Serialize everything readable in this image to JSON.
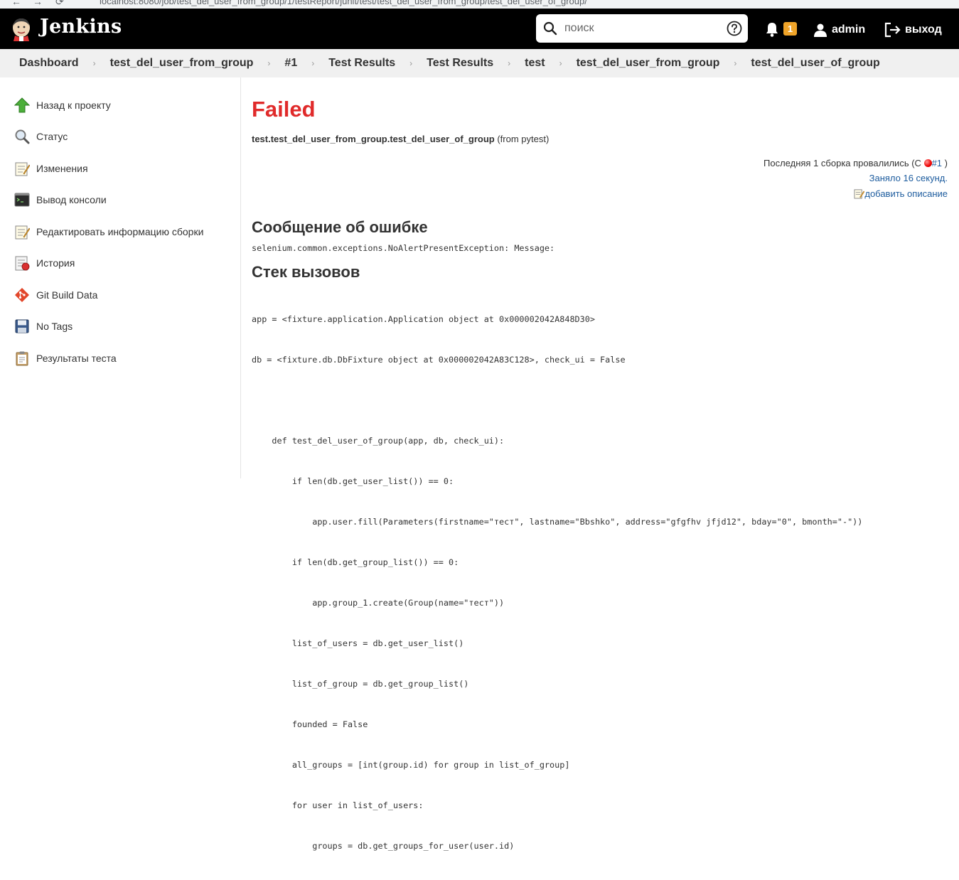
{
  "browser": {
    "url": "localhost:8080/job/test_del_user_from_group/1/testReport/junit/test/test_del_user_from_group/test_del_user_of_group/"
  },
  "header": {
    "brand": "Jenkins",
    "search_placeholder": "поиск",
    "notification_count": "1",
    "user_name": "admin",
    "logout_label": "выход"
  },
  "breadcrumbs": [
    "Dashboard",
    "test_del_user_from_group",
    "#1",
    "Test Results",
    "Test Results",
    "test",
    "test_del_user_from_group",
    "test_del_user_of_group"
  ],
  "sidebar": {
    "items": [
      {
        "label": "Назад к проекту",
        "icon": "up-arrow-icon"
      },
      {
        "label": "Статус",
        "icon": "magnifier-icon"
      },
      {
        "label": "Изменения",
        "icon": "notepad-icon"
      },
      {
        "label": "Вывод консоли",
        "icon": "terminal-icon"
      },
      {
        "label": "Редактировать информацию сборки",
        "icon": "notepad-edit-icon"
      },
      {
        "label": "История",
        "icon": "history-icon"
      },
      {
        "label": "Git Build Data",
        "icon": "git-icon"
      },
      {
        "label": "No Tags",
        "icon": "floppy-icon"
      },
      {
        "label": "Результаты теста",
        "icon": "clipboard-icon"
      }
    ]
  },
  "main": {
    "status": "Failed",
    "test_name": "test.test_del_user_from_group.test_del_user_of_group",
    "test_source": "(from pytest)",
    "failing_since_prefix": "Последняя 1 сборка провалились (С",
    "failing_since_build": "#1",
    "failing_since_suffix": ")",
    "duration": "Заняло 16 секунд.",
    "add_description": "добавить описание",
    "error_heading": "Сообщение об ошибке",
    "error_message": "selenium.common.exceptions.NoAlertPresentException: Message:",
    "stack_heading": "Стек вызовов",
    "stack_lines": [
      "app = <fixture.application.Application object at 0x000002042A848D30>",
      "db = <fixture.db.DbFixture object at 0x000002042A83C128>, check_ui = False",
      "",
      "    def test_del_user_of_group(app, db, check_ui):",
      "        if len(db.get_user_list()) == 0:",
      "            app.user.fill(Parameters(firstname=\"тест\", lastname=\"Bbshko\", address=\"gfgfhv jfjd12\", bday=\"0\", bmonth=\"-\"))",
      "        if len(db.get_group_list()) == 0:",
      "            app.group_1.create(Group(name=\"тест\"))",
      "        list_of_users = db.get_user_list()",
      "        list_of_group = db.get_group_list()",
      "        founded = False",
      "        all_groups = [int(group.id) for group in list_of_group]",
      "        for user in list_of_users:",
      "            groups = db.get_groups_for_user(user.id)"
    ]
  }
}
